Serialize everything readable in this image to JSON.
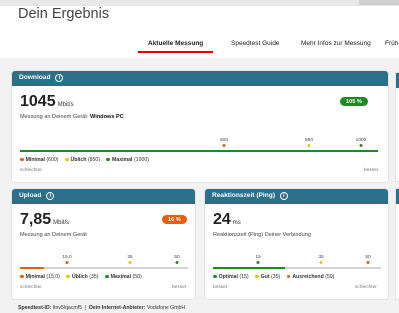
{
  "page": {
    "title": "Dein Ergebnis"
  },
  "tabs": [
    {
      "label": "Aktuelle Messung"
    },
    {
      "label": "Speedtest Guide"
    },
    {
      "label": "Mehr Infos zur Messung"
    },
    {
      "label": "Früh"
    }
  ],
  "download": {
    "header": "Download",
    "value": "1045",
    "unit": "Mbit/s",
    "subtitle_prefix": "Messung an Deinem Gerät:",
    "subtitle_device": "Windows PC",
    "pill": "105 %",
    "fill_fraction": 1.0,
    "ticks": [
      "600",
      "850",
      "1000"
    ],
    "legend": {
      "min": "Minimal",
      "min_val": "(600)",
      "usual": "Üblich",
      "usual_val": "(850)",
      "max": "Maximal",
      "max_val": "(1000)"
    },
    "worse": "schlechter",
    "better": "besser"
  },
  "upload": {
    "header": "Upload",
    "value": "7,85",
    "unit": "Mbit/s",
    "subtitle": "Messung an Deinem Gerät",
    "pill": "16 %",
    "fill_fraction": 0.14,
    "ticks": [
      "15,0",
      "35",
      "50"
    ],
    "legend": {
      "min": "Minimal",
      "min_val": "(15,0)",
      "usual": "Üblich",
      "usual_val": "(35)",
      "max": "Maximal",
      "max_val": "(50)"
    },
    "worse": "schlechter",
    "better": "besser"
  },
  "ping": {
    "header": "Reaktionszeit (Ping)",
    "value": "24",
    "unit": "ms",
    "subtitle": "Reaktionszeit (Ping) Deiner Verbindung",
    "fill_fraction": 0.43,
    "ticks": [
      "15",
      "35",
      "50"
    ],
    "legend": {
      "opt": "Optimal",
      "opt_val": "(15)",
      "good": "Gut",
      "good_val": "(35)",
      "ok": "Ausreichend",
      "ok_val": "(50)"
    },
    "better": "besser",
    "worse": "schlechter"
  },
  "footer": {
    "speedtest_id_label": "Speedtest-ID:",
    "speedtest_id": "ltnv5lqacmf5",
    "separator": "|",
    "provider_label": "Dein Internet-Anbieter:",
    "provider": "Vodafone GmbH"
  },
  "colors": {
    "accent_red": "#e60000",
    "header_blue": "#2b6f8a",
    "green": "#1f8a21",
    "orange": "#e85d10",
    "yellow": "#f4c300"
  },
  "icons": {
    "info": "info-icon"
  }
}
